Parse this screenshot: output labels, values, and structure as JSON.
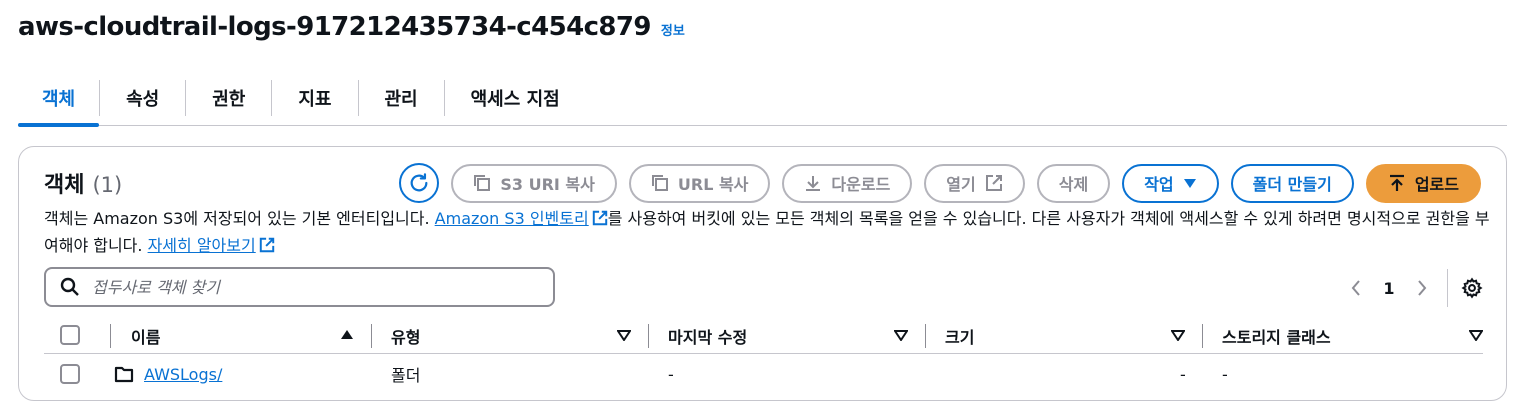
{
  "header": {
    "bucket_name": "aws-cloudtrail-logs-917212435734-c454c879",
    "info_link": "정보"
  },
  "tabs": [
    {
      "label": "객체",
      "active": true
    },
    {
      "label": "속성",
      "active": false
    },
    {
      "label": "권한",
      "active": false
    },
    {
      "label": "지표",
      "active": false
    },
    {
      "label": "관리",
      "active": false
    },
    {
      "label": "액세스 지점",
      "active": false
    }
  ],
  "panel": {
    "title": "객체",
    "count": "(1)",
    "actions": {
      "copy_s3_uri": "S3 URI 복사",
      "copy_url": "URL 복사",
      "download": "다운로드",
      "open": "열기",
      "delete": "삭제",
      "actions_menu": "작업",
      "create_folder": "폴더 만들기",
      "upload": "업로드"
    },
    "description": {
      "part1": "객체는 Amazon S3에 저장되어 있는 기본 엔터티입니다. ",
      "inventory_link": "Amazon S3 인벤토리",
      "part2": "를 사용하여 버킷에 있는 모든 객체의 목록을 얻을 수 있습니다. 다른 사용자가 객체에 액세스할 수 있게 하려면 명시적으로 권한을 부여해야 합니다. ",
      "learn_more_link": "자세히 알아보기"
    },
    "search": {
      "placeholder": "접두사로 객체 찾기",
      "value": ""
    },
    "pagination": {
      "current_page": "1"
    }
  },
  "table": {
    "columns": {
      "name": "이름",
      "type": "유형",
      "last_modified": "마지막 수정",
      "size": "크기",
      "storage_class": "스토리지 클래스"
    },
    "rows": [
      {
        "name": "AWSLogs/",
        "type": "폴더",
        "last_modified": "-",
        "size": "-",
        "storage_class": "-"
      }
    ]
  },
  "colors": {
    "link_blue": "#0972d3",
    "primary_orange": "#ec9c3c",
    "border_gray": "#c6c6cd",
    "disabled_gray": "#8c8c94"
  }
}
